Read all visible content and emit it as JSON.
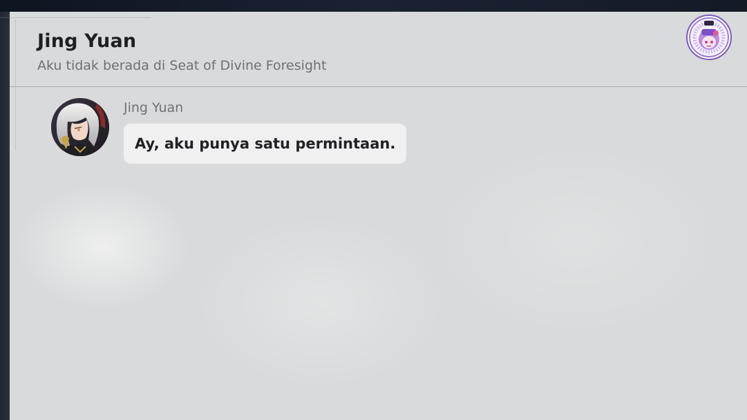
{
  "header": {
    "title": "Jing Yuan",
    "subtitle": "Aku tidak berada di Seat of Divine Foresight",
    "badge_icon": "watermark-logo-icon"
  },
  "conversation": {
    "messages": [
      {
        "sender": "Jing Yuan",
        "avatar_icon": "jing-yuan-avatar",
        "text": "Ay, aku punya satu permintaan."
      }
    ]
  },
  "colors": {
    "panel_background": "#d9dadb",
    "bubble_background": "#f0f0f0",
    "title_text": "#1d1f23",
    "secondary_text": "#6e7074",
    "badge_border": "#7b5bb8"
  }
}
